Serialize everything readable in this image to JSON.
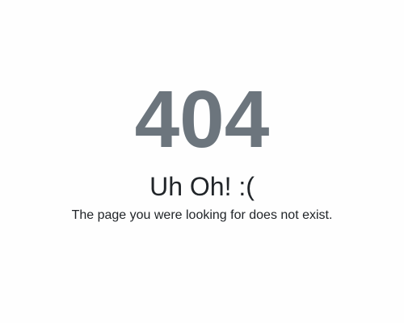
{
  "error": {
    "code": "404",
    "title": "Uh Oh! :(",
    "message": "The page you were looking for does not exist."
  },
  "colors": {
    "code": "#6c757d",
    "text": "#212529",
    "background": "#fefefe"
  }
}
